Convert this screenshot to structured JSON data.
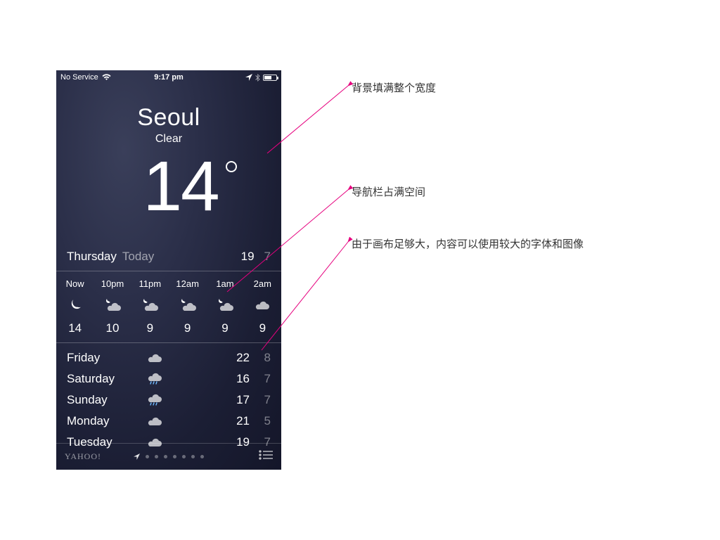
{
  "status": {
    "carrier": "No Service",
    "time": "9:17 pm"
  },
  "header": {
    "city": "Seoul",
    "condition": "Clear",
    "temp": "14"
  },
  "today": {
    "day": "Thursday",
    "label": "Today",
    "hi": "19",
    "lo": "7"
  },
  "hourly": [
    {
      "label": "Now",
      "icon": "moon",
      "temp": "14",
      "now": true
    },
    {
      "label": "10pm",
      "icon": "cloud-night",
      "temp": "10"
    },
    {
      "label": "11pm",
      "icon": "cloud-night",
      "temp": "9"
    },
    {
      "label": "12am",
      "icon": "cloud-night",
      "temp": "9"
    },
    {
      "label": "1am",
      "icon": "cloud-night",
      "temp": "9"
    },
    {
      "label": "2am",
      "icon": "cloud",
      "temp": "9"
    }
  ],
  "daily": [
    {
      "day": "Friday",
      "icon": "cloud",
      "hi": "22",
      "lo": "8"
    },
    {
      "day": "Saturday",
      "icon": "cloud-rain",
      "hi": "16",
      "lo": "7"
    },
    {
      "day": "Sunday",
      "icon": "cloud-rain",
      "hi": "17",
      "lo": "7"
    },
    {
      "day": "Monday",
      "icon": "cloud",
      "hi": "21",
      "lo": "5"
    },
    {
      "day": "Tuesday",
      "icon": "cloud",
      "hi": "19",
      "lo": "7"
    }
  ],
  "footer": {
    "brand": "YAHOO",
    "brand_bang": "!",
    "pages": 8,
    "active_page": 0
  },
  "annotations": {
    "a1": "背景填满整个宽度",
    "a2": "导航栏占满空间",
    "a3": "由于画布足够大，内容可以使用较大的字体和图像"
  }
}
